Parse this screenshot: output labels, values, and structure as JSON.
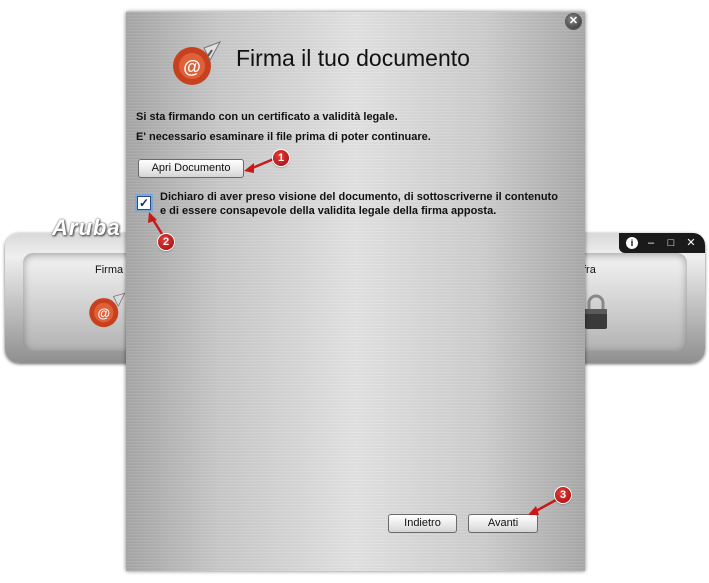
{
  "background_app": {
    "brand": "Aruba",
    "left_label": "Firma",
    "right_label": "fra",
    "controls": {
      "info": "i",
      "minimize": "–",
      "maximize": "□",
      "close": "✕"
    }
  },
  "dialog": {
    "close": "✕",
    "title": "Firma il tuo documento",
    "info_line1": "Si sta firmando con un certificato a validità legale.",
    "info_line2": "E' necessario esaminare il file prima di poter continuare.",
    "open_button": "Apri Documento",
    "checkbox_mark": "✓",
    "declaration": "Dichiaro di aver preso visione del documento, di sottoscriverne il contenuto e di essere consapevole della validita legale della firma apposta.",
    "back_button": "Indietro",
    "next_button": "Avanti"
  },
  "annotations": [
    "1",
    "2",
    "3"
  ],
  "colors": {
    "badge": "#c81818",
    "checkbox_border": "#2c4a7c"
  }
}
